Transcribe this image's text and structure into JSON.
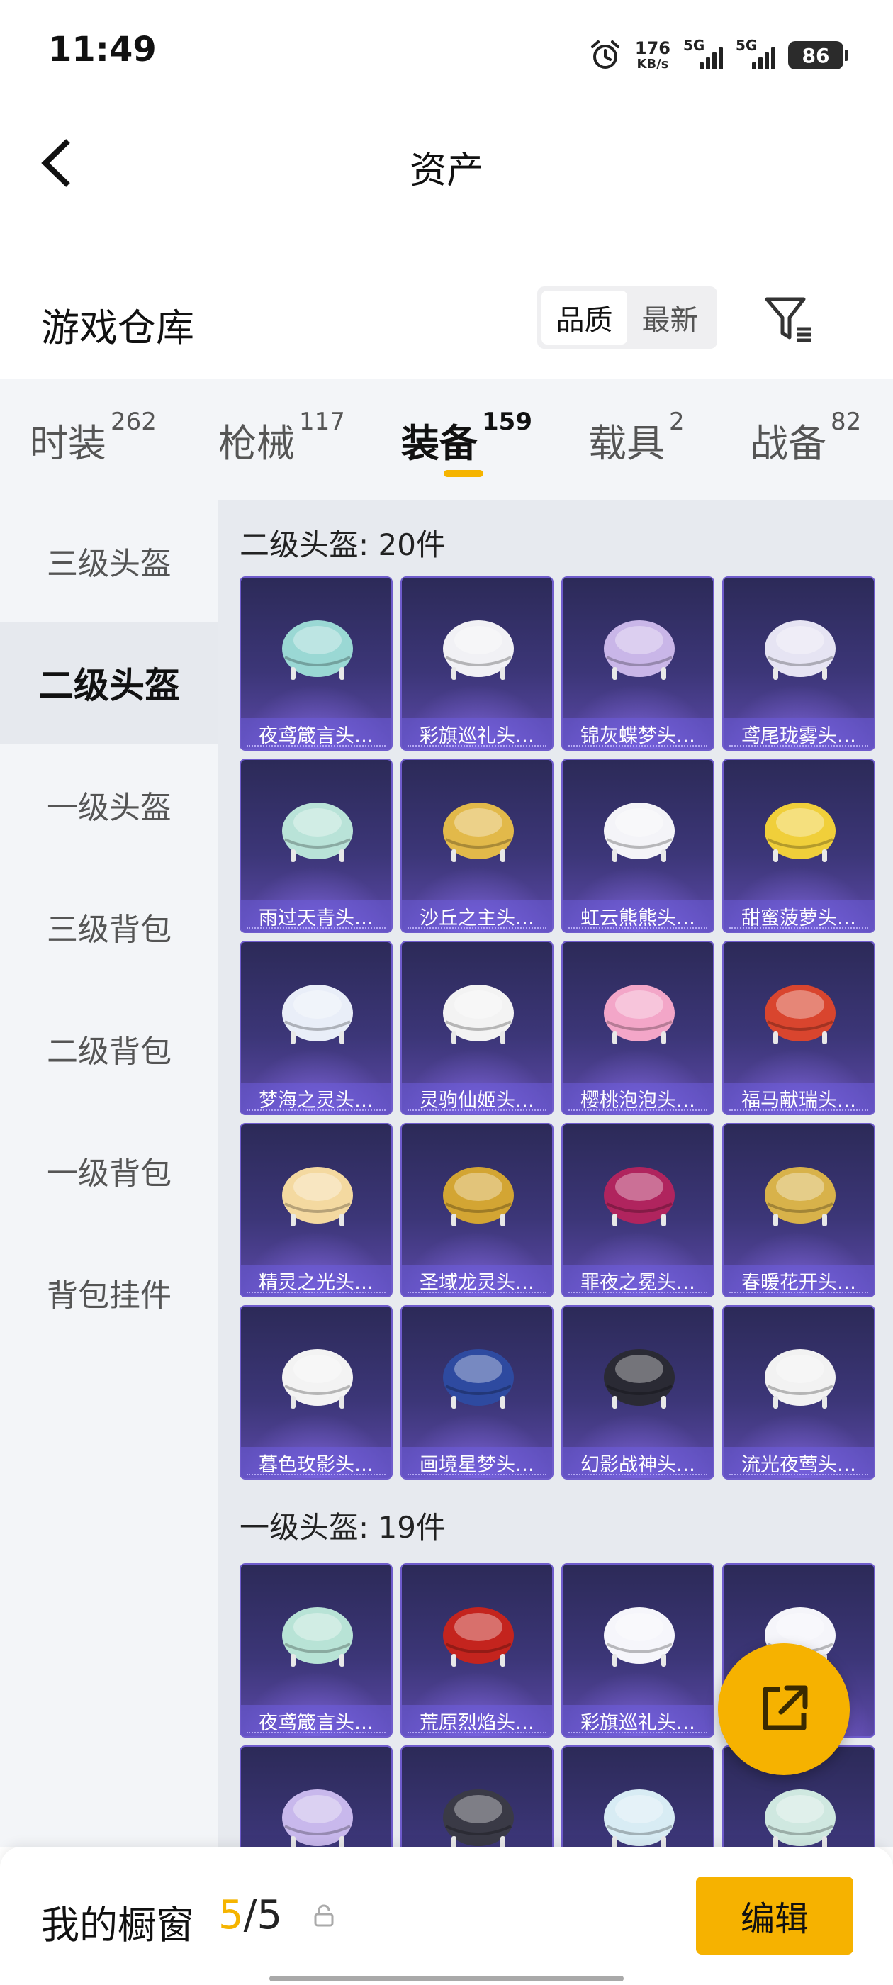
{
  "status_bar": {
    "time": "11:49",
    "net_speed_value": "176",
    "net_speed_unit": "KB/s",
    "sim1": "5G",
    "sim2": "5G",
    "battery": "86",
    "icons": [
      "alarm-icon",
      "signal-icon",
      "battery-icon"
    ]
  },
  "header": {
    "title": "资产",
    "back_icon": "chevron-left-icon"
  },
  "warehouse": {
    "title": "游戏仓库",
    "sort_options": [
      "品质",
      "最新"
    ],
    "sort_selected": "品质",
    "filter_icon": "filter-icon"
  },
  "tabs": [
    {
      "label": "时装",
      "count": "262"
    },
    {
      "label": "枪械",
      "count": "117"
    },
    {
      "label": "装备",
      "count": "159"
    },
    {
      "label": "载具",
      "count": "2"
    },
    {
      "label": "战备",
      "count": "82"
    }
  ],
  "active_tab": "装备",
  "sidenav": [
    "三级头盔",
    "二级头盔",
    "一级头盔",
    "三级背包",
    "二级背包",
    "一级背包",
    "背包挂件"
  ],
  "sidenav_active": "二级头盔",
  "sections": [
    {
      "title": "二级头盔: 20件",
      "items": [
        "夜鸢箴言头…",
        "彩旗巡礼头…",
        "锦灰蝶梦头…",
        "鸢尾珑雾头…",
        "雨过天青头…",
        "沙丘之主头…",
        "虹云熊熊头…",
        "甜蜜菠萝头…",
        "梦海之灵头…",
        "灵驹仙姬头…",
        "樱桃泡泡头…",
        "福马献瑞头…",
        "精灵之光头…",
        "圣域龙灵头…",
        "罪夜之冕头…",
        "春暖花开头…",
        "暮色玫影头…",
        "画境星梦头…",
        "幻影战神头…",
        "流光夜莺头…"
      ]
    },
    {
      "title": "一级头盔: 19件",
      "items": [
        "夜鸢箴言头…",
        "荒原烈焰头…",
        "彩旗巡礼头…",
        "",
        "",
        "",
        "",
        ""
      ]
    }
  ],
  "fab": {
    "icon": "share-icon"
  },
  "bottom_bar": {
    "label": "我的橱窗",
    "count_current": "5",
    "count_separator": "/",
    "count_total": "5",
    "lock_icon": "lock-icon",
    "edit_label": "编辑"
  },
  "colors": {
    "accent": "#f6b200",
    "card_bg": "#3c3678",
    "card_border": "#6f5ccc",
    "panel_bg": "#f3f5f8"
  }
}
